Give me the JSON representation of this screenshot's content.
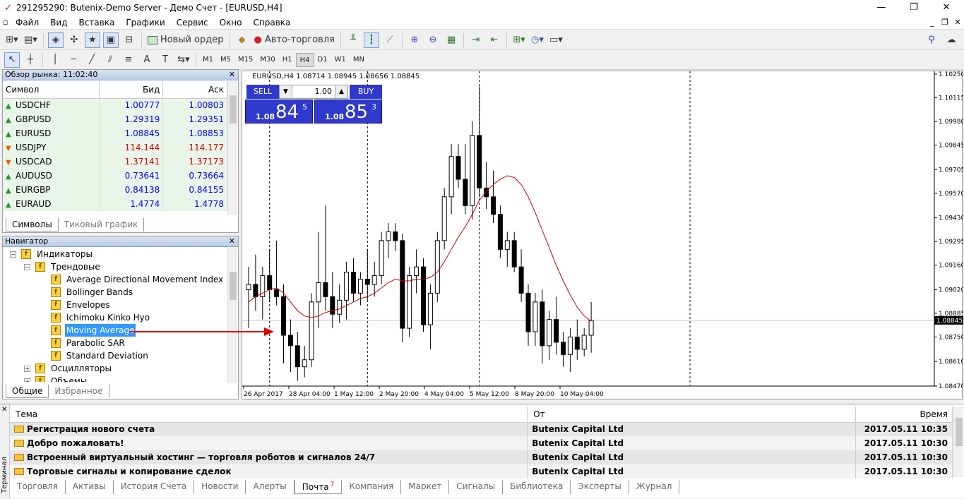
{
  "window": {
    "title": "291295290: Butenix-Demo Server - Демо Счет - [EURUSD,H4]"
  },
  "menu": [
    "Файл",
    "Вид",
    "Вставка",
    "Графики",
    "Сервис",
    "Окно",
    "Справка"
  ],
  "toolbar": {
    "new_order": "Новый ордер",
    "autotrading": "Авто-торговля"
  },
  "timeframes": [
    "M1",
    "M5",
    "M15",
    "M30",
    "H1",
    "H4",
    "D1",
    "W1",
    "MN"
  ],
  "active_timeframe": "H4",
  "market_watch": {
    "title": "Обзор рынка: 11:02:40",
    "columns": [
      "Символ",
      "Бид",
      "Аск"
    ],
    "rows": [
      {
        "symbol": "USDCHF",
        "bid": "1.00777",
        "ask": "1.00803",
        "dir": "up"
      },
      {
        "symbol": "GBPUSD",
        "bid": "1.29319",
        "ask": "1.29351",
        "dir": "up"
      },
      {
        "symbol": "EURUSD",
        "bid": "1.08845",
        "ask": "1.08853",
        "dir": "up"
      },
      {
        "symbol": "USDJPY",
        "bid": "114.144",
        "ask": "114.177",
        "dir": "down"
      },
      {
        "symbol": "USDCAD",
        "bid": "1.37141",
        "ask": "1.37173",
        "dir": "down"
      },
      {
        "symbol": "AUDUSD",
        "bid": "0.73641",
        "ask": "0.73664",
        "dir": "up"
      },
      {
        "symbol": "EURGBP",
        "bid": "0.84138",
        "ask": "0.84155",
        "dir": "up"
      },
      {
        "symbol": "EURAUD",
        "bid": "1.4774",
        "ask": "1.4778",
        "dir": "up"
      }
    ],
    "tabs": [
      "Символы",
      "Тиковый график"
    ]
  },
  "navigator": {
    "title": "Навигатор",
    "root": "Индикаторы",
    "group": "Трендовые",
    "items": [
      "Average Directional Movement Index",
      "Bollinger Bands",
      "Envelopes",
      "Ichimoku Kinko Hyo",
      "Moving Average",
      "Parabolic SAR",
      "Standard Deviation"
    ],
    "selected": "Moving Average",
    "other_groups": [
      "Осцилляторы",
      "Объемы"
    ],
    "tabs": [
      "Общие",
      "Избранное"
    ]
  },
  "chart": {
    "header": "EURUSD,H4  1.08714 1.08945 1.08656 1.08845",
    "sell_label": "SELL",
    "buy_label": "BUY",
    "lot": "1.00",
    "sell_price": {
      "prefix": "1.08",
      "big": "84",
      "sup": "5"
    },
    "buy_price": {
      "prefix": "1.08",
      "big": "85",
      "sup": "3"
    },
    "current_price": "1.08845"
  },
  "chart_data": {
    "type": "candlestick",
    "symbol": "EURUSD",
    "timeframe": "H4",
    "y_ticks": [
      "1.10250",
      "1.10115",
      "1.09980",
      "1.09845",
      "1.09705",
      "1.09570",
      "1.09430",
      "1.09295",
      "1.09160",
      "1.09020",
      "1.08885",
      "1.08750",
      "1.08610",
      "1.08470"
    ],
    "ylim": [
      1.0847,
      1.1025
    ],
    "x_ticks": [
      "26 Apr 2017",
      "28 Apr 04:00",
      "1 May 12:00",
      "2 May 20:00",
      "4 May 04:00",
      "5 May 12:00",
      "8 May 20:00",
      "10 May 04:00"
    ],
    "current_price": 1.08845,
    "ohlc": [
      [
        1.0902,
        1.0915,
        1.088,
        1.0905
      ],
      [
        1.0905,
        1.0922,
        1.089,
        1.0898
      ],
      [
        1.0898,
        1.0915,
        1.0885,
        1.091
      ],
      [
        1.091,
        1.0925,
        1.0895,
        1.0902
      ],
      [
        1.0902,
        1.093,
        1.0893,
        1.0898
      ],
      [
        1.0898,
        1.0905,
        1.086,
        1.0876
      ],
      [
        1.0876,
        1.0885,
        1.0855,
        1.087
      ],
      [
        1.087,
        1.0878,
        1.085,
        1.0858
      ],
      [
        1.0858,
        1.087,
        1.0852,
        1.0862
      ],
      [
        1.0862,
        1.09,
        1.0858,
        1.0895
      ],
      [
        1.0895,
        1.0935,
        1.088,
        1.0906
      ],
      [
        1.0906,
        1.095,
        1.089,
        1.0898
      ],
      [
        1.0898,
        1.0912,
        1.088,
        1.0888
      ],
      [
        1.0888,
        1.0905,
        1.0883,
        1.0896
      ],
      [
        1.0896,
        1.0918,
        1.0885,
        1.0912
      ],
      [
        1.0912,
        1.092,
        1.0895,
        1.09
      ],
      [
        1.09,
        1.0912,
        1.0893,
        1.0908
      ],
      [
        1.0908,
        1.0925,
        1.0896,
        1.0905
      ],
      [
        1.0905,
        1.0918,
        1.0898,
        1.091
      ],
      [
        1.091,
        1.0935,
        1.0905,
        1.093
      ],
      [
        1.093,
        1.094,
        1.092,
        1.0935
      ],
      [
        1.0935,
        1.094,
        1.0924,
        1.093
      ],
      [
        1.093,
        1.0934,
        1.0872,
        1.088
      ],
      [
        1.088,
        1.0915,
        1.0875,
        1.091
      ],
      [
        1.091,
        1.0925,
        1.09,
        1.0915
      ],
      [
        1.0915,
        1.092,
        1.0878,
        1.0882
      ],
      [
        1.0882,
        1.0905,
        1.0868,
        1.09
      ],
      [
        1.09,
        1.0935,
        1.0895,
        1.093
      ],
      [
        1.093,
        1.096,
        1.0925,
        1.0955
      ],
      [
        1.0955,
        1.0985,
        1.0945,
        1.0978
      ],
      [
        1.0978,
        1.0985,
        1.096,
        1.0965
      ],
      [
        1.0965,
        1.0985,
        1.0945,
        1.095
      ],
      [
        1.095,
        1.0998,
        1.0942,
        1.099
      ],
      [
        1.099,
        1.1018,
        1.0955,
        1.096
      ],
      [
        1.096,
        1.0975,
        1.0948,
        1.0955
      ],
      [
        1.0955,
        1.097,
        1.094,
        1.0945
      ],
      [
        1.0945,
        1.095,
        1.092,
        1.0925
      ],
      [
        1.0925,
        1.0935,
        1.0915,
        1.093
      ],
      [
        1.093,
        1.0935,
        1.0912,
        1.0915
      ],
      [
        1.0915,
        1.0925,
        1.0895,
        1.09
      ],
      [
        1.09,
        1.0905,
        1.087,
        1.0878
      ],
      [
        1.0878,
        1.09,
        1.087,
        1.0895
      ],
      [
        1.0895,
        1.0902,
        1.086,
        1.087
      ],
      [
        1.087,
        1.089,
        1.0862,
        1.0885
      ],
      [
        1.0885,
        1.0898,
        1.0865,
        1.0872
      ],
      [
        1.0872,
        1.0878,
        1.0858,
        1.0865
      ],
      [
        1.0865,
        1.088,
        1.0855,
        1.0875
      ],
      [
        1.0875,
        1.0885,
        1.0862,
        1.0868
      ],
      [
        1.0868,
        1.088,
        1.0864,
        1.0876
      ],
      [
        1.0876,
        1.0895,
        1.0866,
        1.08845
      ]
    ],
    "ma": [
      1.0895,
      1.0898,
      1.09,
      1.0902,
      1.0903,
      1.09,
      1.0895,
      1.089,
      1.0887,
      1.0886,
      1.0887,
      1.0889,
      1.089,
      1.0891,
      1.0893,
      1.0895,
      1.0897,
      1.0898,
      1.09,
      1.0903,
      1.0906,
      1.0908,
      1.0907,
      1.0907,
      1.0908,
      1.0908,
      1.0909,
      1.0912,
      1.0918,
      1.0925,
      1.0932,
      1.0938,
      1.0945,
      1.0953,
      1.0958,
      1.0962,
      1.0965,
      1.0967,
      1.0966,
      1.0962,
      1.0955,
      1.0946,
      1.0936,
      1.0926,
      1.0916,
      1.0907,
      1.0899,
      1.0892,
      1.0887,
      1.0884
    ],
    "period_separators_x_index": [
      3,
      17,
      33
    ],
    "right_separator": true
  },
  "terminal": {
    "side_label": "Терминал",
    "columns": [
      "Тема",
      "От",
      "Время"
    ],
    "rows": [
      {
        "subject": "Регистрация нового счета",
        "from": "Butenix Capital Ltd",
        "time": "2017.05.11 10:35"
      },
      {
        "subject": "Добро пожаловать!",
        "from": "Butenix Capital Ltd",
        "time": "2017.05.11 10:30"
      },
      {
        "subject": "Встроенный виртуальный хостинг — торговля роботов и сигналов 24/7",
        "from": "Butenix Capital Ltd",
        "time": "2017.05.11 10:30"
      },
      {
        "subject": "Торговые сигналы и копирование сделок",
        "from": "Butenix Capital Ltd",
        "time": "2017.05.11 10:30"
      }
    ],
    "tabs": [
      "Торговля",
      "Активы",
      "История Счета",
      "Новости",
      "Алерты",
      "Почта",
      "Компания",
      "Маркет",
      "Сигналы",
      "Библиотека",
      "Эксперты",
      "Журнал"
    ],
    "active_tab": "Почта",
    "mail_badge": "7"
  },
  "colors": {
    "accent": "#2f3acc",
    "bid_up": "#0000ff",
    "bid_down": "#e00000",
    "ma_line": "#cc0000",
    "arrow": "#e00000"
  }
}
